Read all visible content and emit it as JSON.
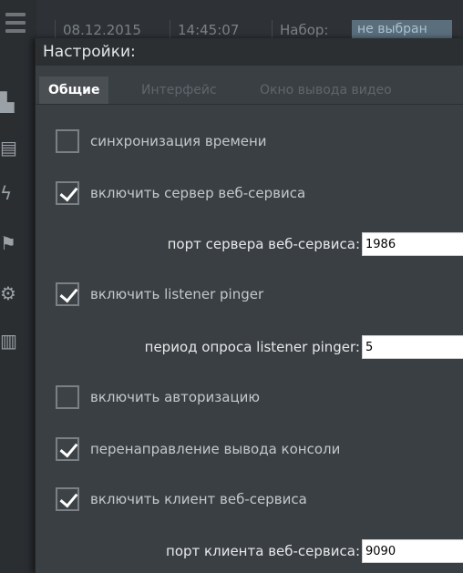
{
  "app": {
    "date": "08.12.2015",
    "time": "14:45:07",
    "set_label": "Набор:",
    "set_value": "не выбран"
  },
  "sidebar_icons": [
    "video-monitor-icon",
    "screens-icon",
    "lightning-icon",
    "flag-icon",
    "gear-icon",
    "clipboard-icon"
  ],
  "dialog": {
    "title": "Настройки:",
    "tabs": [
      {
        "label": "Общие",
        "active": true
      },
      {
        "label": "Интерфейс",
        "active": false
      },
      {
        "label": "Окно вывода видео",
        "active": false
      }
    ]
  },
  "settings": {
    "time_sync": {
      "label": "синхронизация времени",
      "checked": false
    },
    "web_server": {
      "label": "включить сервер веб-сервиса",
      "checked": true
    },
    "web_server_port": {
      "label": "порт сервера веб-сервиса:",
      "value": "1986"
    },
    "listener_pinger": {
      "label": "включить listener pinger",
      "checked": true
    },
    "pinger_period": {
      "label": "период опроса listener pinger:",
      "value": "5"
    },
    "authorization": {
      "label": "включить авторизацию",
      "checked": false
    },
    "console_redirect": {
      "label": "перенаправление вывода консоли",
      "checked": true
    },
    "web_client": {
      "label": "включить клиент веб-сервиса",
      "checked": true
    },
    "web_client_port": {
      "label": "порт клиента веб-сервиса:",
      "value": "9090"
    }
  },
  "colors": {
    "dialog_bg": "#3a3f43",
    "title_bg": "#2b2f32",
    "active_tab_bg": "#4a4f54",
    "checkbox_border": "#7a8086"
  }
}
